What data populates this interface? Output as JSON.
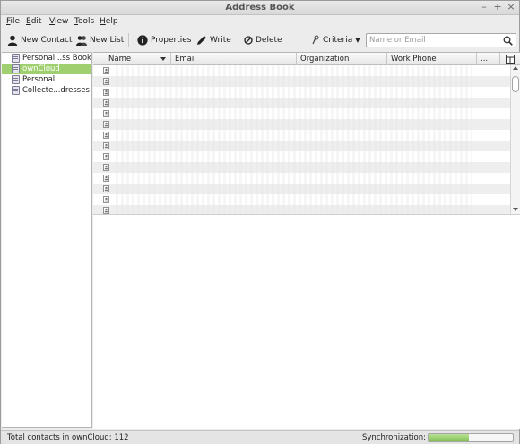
{
  "window": {
    "title": "Address Book"
  },
  "menu": [
    {
      "label": "File"
    },
    {
      "label": "Edit"
    },
    {
      "label": "View"
    },
    {
      "label": "Tools"
    },
    {
      "label": "Help"
    }
  ],
  "toolbar": {
    "new_contact": "New Contact",
    "new_list": "New List",
    "properties": "Properties",
    "write": "Write",
    "delete": "Delete",
    "criteria": "Criteria"
  },
  "search": {
    "placeholder": "Name or Email",
    "value": ""
  },
  "sidebar": {
    "items": [
      {
        "label": "Personal...ss Book",
        "selected": false
      },
      {
        "label": "ownCloud",
        "selected": true
      },
      {
        "label": "Personal",
        "selected": false
      },
      {
        "label": "Collecte...dresses",
        "selected": false
      }
    ]
  },
  "table": {
    "columns": [
      "Name",
      "Email",
      "Organization",
      "Work Phone",
      "..."
    ],
    "visible_row_count": 14
  },
  "status": {
    "total": "Total contacts in ownCloud: 112",
    "sync_label": "Synchronization:",
    "sync_progress": 0.48
  },
  "colors": {
    "selection": "#9fcf6f",
    "progress": "#82c052"
  },
  "icons": [
    "contact-icon",
    "list-icon",
    "info-icon",
    "pencil-icon",
    "delete-icon",
    "criteria-icon",
    "search-icon",
    "address-book-icon",
    "column-picker-icon",
    "card-icon"
  ]
}
